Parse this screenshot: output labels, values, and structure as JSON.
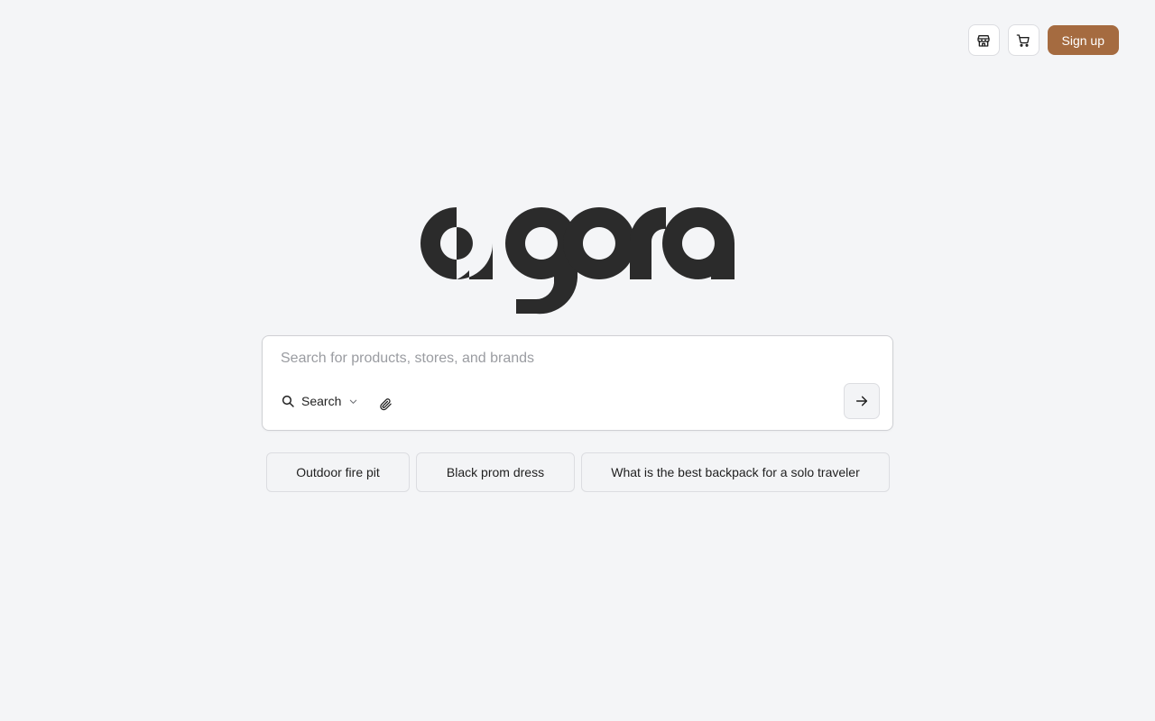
{
  "header": {
    "store_icon": "storefront-icon",
    "cart_icon": "shopping-cart-icon",
    "signup_label": "Sign up"
  },
  "logo": {
    "text": "agora",
    "color": "#2b2b2b"
  },
  "search": {
    "placeholder": "Search for products, stores, and brands",
    "value": "",
    "mode_label": "Search",
    "mode_icon": "search-icon",
    "attach_icon": "paperclip-icon",
    "submit_icon": "arrow-right-icon"
  },
  "suggestions": [
    {
      "label": "Outdoor fire pit"
    },
    {
      "label": "Black prom dress"
    },
    {
      "label": "What is the best backpack for a solo traveler"
    }
  ],
  "colors": {
    "background": "#f4f5f7",
    "accent": "#a56b40",
    "logo": "#2b2b2b"
  }
}
